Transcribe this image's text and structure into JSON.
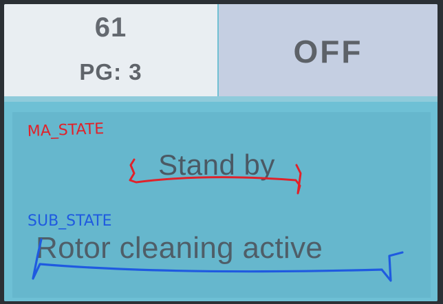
{
  "header": {
    "count": "61",
    "page_label": "PG: 3",
    "power_state": "OFF"
  },
  "states": {
    "main_state_value": "Stand by",
    "sub_state_value": "Rotor cleaning active"
  },
  "annotations": {
    "main_label": "MA_STATE",
    "sub_label": "SUB_STATE",
    "main_color": "#e0222a",
    "sub_color": "#1f5ae0"
  },
  "colors": {
    "screen_bg": "#6fbfd2",
    "header_left_bg": "#e9eef2",
    "header_right_bg": "#c5cfe2"
  }
}
